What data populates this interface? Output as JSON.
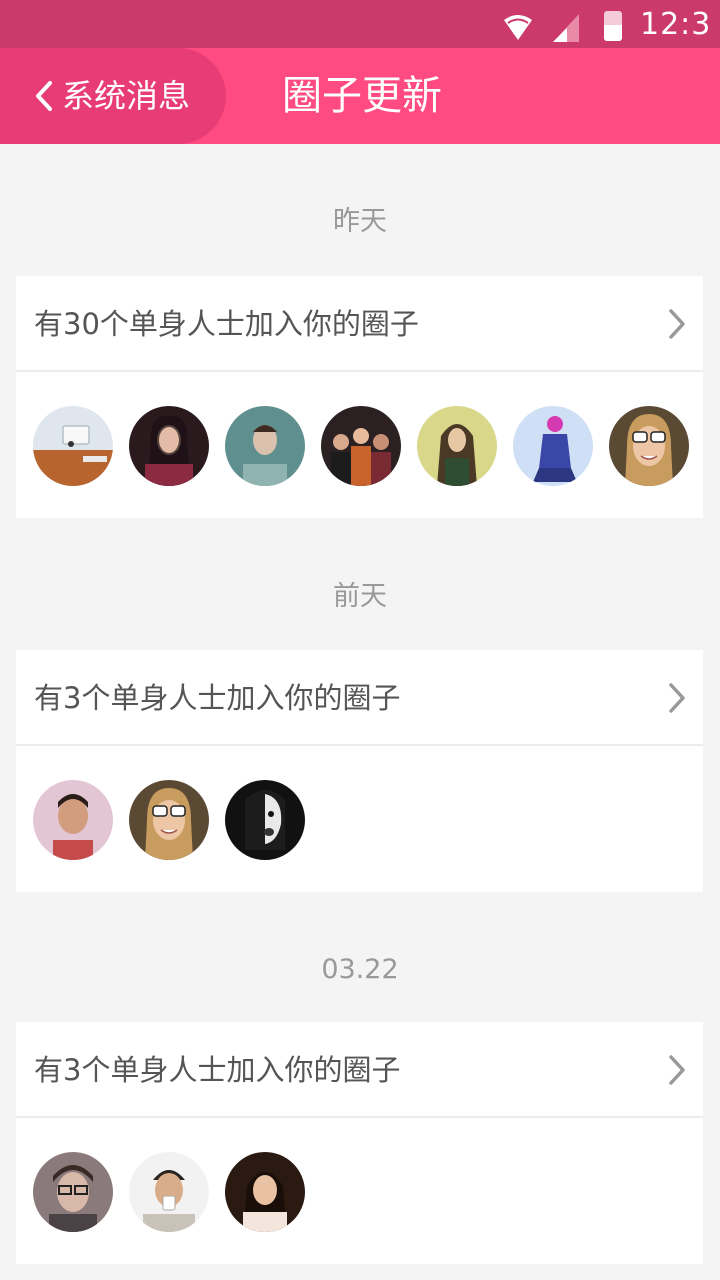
{
  "status_bar": {
    "time": "12:3",
    "icons": [
      "wifi-icon",
      "cell-signal-icon",
      "battery-icon"
    ]
  },
  "header": {
    "back_label": "系统消息",
    "title": "圈子更新",
    "colors": {
      "status_bar": "#cc3a6b",
      "app_bar": "#ff4a82",
      "back_pill": "#e83c76"
    }
  },
  "groups": [
    {
      "date": "昨天",
      "message": "有30个单身人士加入你的圈子",
      "avatar_count": 7
    },
    {
      "date": "前天",
      "message": "有3个单身人士加入你的圈子",
      "avatar_count": 3
    },
    {
      "date": "03.22",
      "message": "有3个单身人士加入你的圈子",
      "avatar_count": 3
    }
  ],
  "colors": {
    "background": "#f4f4f4",
    "card": "#ffffff",
    "date_text": "#999999",
    "message_text": "#555555"
  }
}
